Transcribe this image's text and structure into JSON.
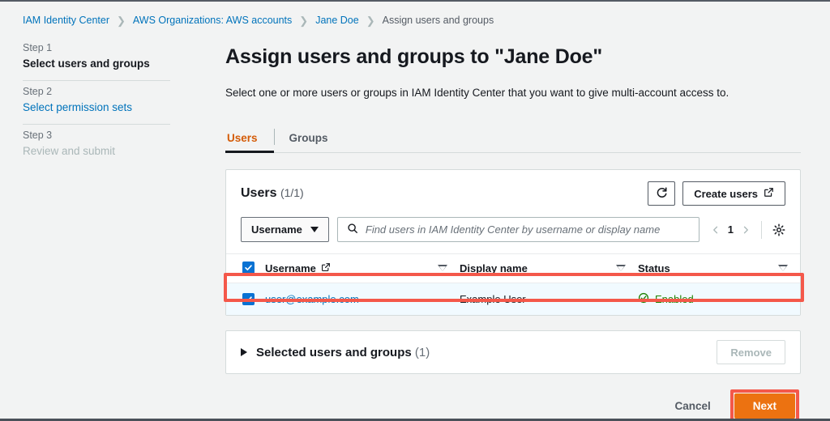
{
  "breadcrumb": [
    {
      "label": "IAM Identity Center",
      "type": "link"
    },
    {
      "label": "AWS Organizations: AWS accounts",
      "type": "link"
    },
    {
      "label": "Jane Doe",
      "type": "link"
    },
    {
      "label": "Assign users and groups",
      "type": "current"
    }
  ],
  "sidebar": {
    "steps": [
      {
        "num": "Step 1",
        "label": "Select users and groups",
        "state": "active"
      },
      {
        "num": "Step 2",
        "label": "Select permission sets",
        "state": "link"
      },
      {
        "num": "Step 3",
        "label": "Review and submit",
        "state": "disabled"
      }
    ]
  },
  "page": {
    "title": "Assign users and groups to \"Jane Doe\"",
    "description": "Select one or more users or groups in IAM Identity Center that you want to give multi-account access to."
  },
  "tabs": [
    {
      "label": "Users",
      "active": true
    },
    {
      "label": "Groups",
      "active": false
    }
  ],
  "card": {
    "title": "Users",
    "count": "(1/1)",
    "refresh_icon": "refresh-icon",
    "create_users_label": "Create users",
    "external_link_icon": "external-link-icon",
    "filter": {
      "select_value": "Username",
      "search_placeholder": "Find users in IAM Identity Center by username or display name",
      "search_value": "",
      "search_icon": "search-icon",
      "page_number": "1",
      "prev_icon": "chevron-left-icon",
      "next_icon": "chevron-right-icon",
      "settings_icon": "gear-icon"
    },
    "table": {
      "columns": [
        {
          "label": "Username",
          "has_external_link": true
        },
        {
          "label": "Display name",
          "has_external_link": false
        },
        {
          "label": "Status",
          "has_external_link": false
        }
      ],
      "header_checkbox_checked": true,
      "rows": [
        {
          "checked": true,
          "username": "user@example.com",
          "display_name": "Example User",
          "status": "Enabled",
          "status_icon": "status-positive-icon"
        }
      ]
    }
  },
  "selected_section": {
    "title": "Selected users and groups",
    "count": "(1)",
    "expand_icon": "triangle-right-icon",
    "remove_label": "Remove"
  },
  "footer": {
    "cancel_label": "Cancel",
    "next_label": "Next"
  },
  "colors": {
    "accent_orange": "#ec7211",
    "link_blue": "#0073bb",
    "checkbox_blue": "#0972d3",
    "status_green": "#1d8102",
    "annotation_red": "#f4584a",
    "page_bg": "#f2f3f3",
    "tab_active": "#d45b07"
  }
}
